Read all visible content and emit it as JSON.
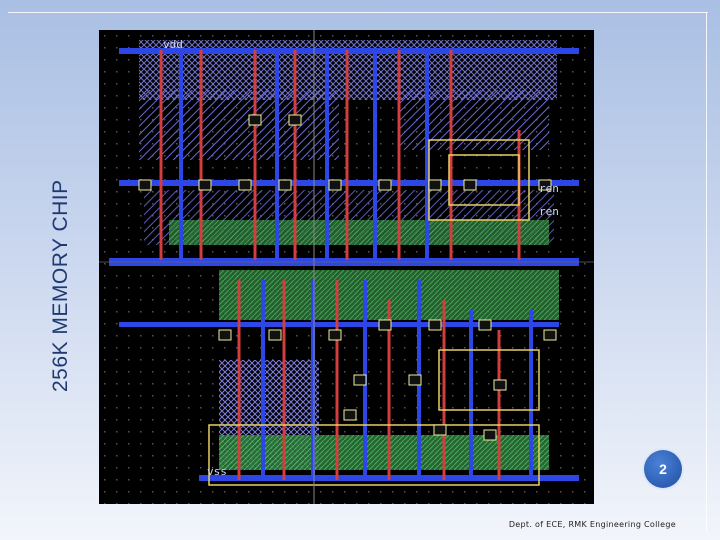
{
  "slide": {
    "title": "256K MEMORY CHIP",
    "page_number": "2",
    "footer": "Dept. of ECE, RMK Engineering College"
  },
  "layout": {
    "labels": [
      "vdd",
      "ren",
      "ren",
      "vss"
    ],
    "colors": {
      "background": "#000000",
      "metal1": "#2c47e6",
      "metal2": "#9a8fcf",
      "poly": "#d23d3d",
      "diffusion": "#3aa14a",
      "contact": "#f0f0a0",
      "well": "#e8d060"
    }
  },
  "colors": {
    "title": "#1f3a73",
    "badge": "#2f63bd"
  }
}
